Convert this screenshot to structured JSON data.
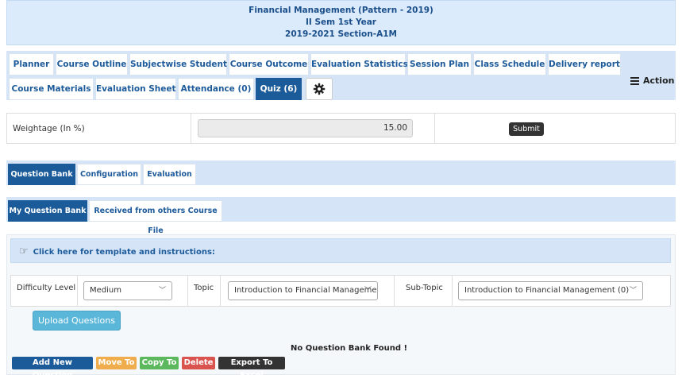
{
  "header": {
    "course": "Financial Management (Pattern - 2019)",
    "semester": "II Sem 1st Year",
    "section": "2019-2021 Section-A1M"
  },
  "main_tabs": [
    {
      "label": "Planner"
    },
    {
      "label": "Course Outline"
    },
    {
      "label": "Subjectwise Student"
    },
    {
      "label": "Course Outcome"
    },
    {
      "label": "Evaluation Statistics"
    },
    {
      "label": "Session Plan"
    },
    {
      "label": "Class Schedule"
    },
    {
      "label": "Delivery report"
    },
    {
      "label": "Course Materials"
    },
    {
      "label": "Evaluation Sheet"
    },
    {
      "label": "Attendance (0)"
    },
    {
      "label": "Quiz (6)",
      "active": true
    }
  ],
  "action_label": "Action",
  "weightage": {
    "label": "Weightage (In %)",
    "value": "15.00",
    "submit_label": "Submit"
  },
  "section_tabs": [
    {
      "label": "Question Bank",
      "active": true
    },
    {
      "label": "Configuration"
    },
    {
      "label": "Evaluation"
    }
  ],
  "bank_tabs": [
    {
      "label": "My Question Bank",
      "active": true
    },
    {
      "label": "Received from others Course File"
    }
  ],
  "instructions_text": "Click here for template and instructions:",
  "filters": {
    "difficulty_label": "Difficulty Level",
    "difficulty_value": "Medium",
    "topic_label": "Topic",
    "topic_value": "Introduction to Financial Managemen",
    "subtopic_label": "Sub-Topic",
    "subtopic_value": "Introduction to Financial Management (0)"
  },
  "upload_label": "Upload Questions",
  "empty_message": "No Question Bank Found !",
  "actions": [
    {
      "label": "Add New Question",
      "color": "#1b5b9a"
    },
    {
      "label": "Move To",
      "color": "#f0ad4e"
    },
    {
      "label": "Copy To",
      "color": "#5cb85c"
    },
    {
      "label": "Delete",
      "color": "#d9534f"
    },
    {
      "label": "Export To Excel",
      "color": "#333333"
    }
  ],
  "colors": {
    "accent": "#1b5b9a",
    "tab_bar": "#d5e5f7",
    "header_bg": "#dcebfb"
  }
}
